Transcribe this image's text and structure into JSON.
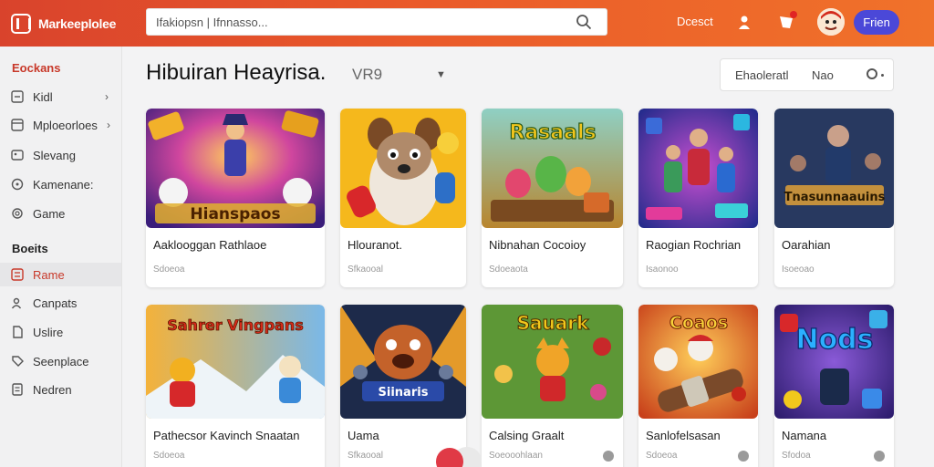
{
  "app": {
    "name": "Markeeplolee"
  },
  "header": {
    "search_text": "Ifakiopsn | Ifnnasso...",
    "link": "Dcesct",
    "notif_badge": "",
    "button": "Frien"
  },
  "sidebar": {
    "section1": "Eockans",
    "items1": [
      {
        "label": "Kidl",
        "chev": "›"
      },
      {
        "label": "Mploeorloes",
        "chev": "›"
      },
      {
        "label": "Slevang",
        "chev": ""
      },
      {
        "label": "Kamenane:",
        "chev": ""
      },
      {
        "label": "Game",
        "chev": ""
      }
    ],
    "section2": "Boeits",
    "items2": [
      {
        "label": "Rame"
      },
      {
        "label": "Canpats"
      },
      {
        "label": "Uslire"
      },
      {
        "label": "Seenplace"
      },
      {
        "label": "Nedren"
      }
    ]
  },
  "main": {
    "title": "Hibuiran Heayrisa.",
    "version": "VR9",
    "filter": {
      "a": "Ehaoleratl",
      "b": "Nao"
    }
  },
  "cards": [
    {
      "title": "Aaklooggan Rathlaoe",
      "sub": "Sdoeoa",
      "art": "Hianspaos"
    },
    {
      "title": "Hlouranot.",
      "sub": "Sfkaooal",
      "art": ""
    },
    {
      "title": "Nibnahan Cocoioy",
      "sub": "Sdoeaota",
      "art": "Rasaals"
    },
    {
      "title": "Raogian Rochrian",
      "sub": "Isaonoo",
      "art": ""
    },
    {
      "title": "Oarahian",
      "sub": "Isoeoao",
      "art": "Tnasunnaauins"
    },
    {
      "title": "Pathecsor Kavinch Snaatan",
      "sub": "Sdoeoa",
      "art": "Sahrer Vingpans"
    },
    {
      "title": "Uama",
      "sub": "Sfkaooal",
      "art": "Siinaris"
    },
    {
      "title": "Calsing Graalt",
      "sub": "Soeooohlaan",
      "art": "Sauark"
    },
    {
      "title": "Sanlofelsasan",
      "sub": "Sdoeoa",
      "art": "Coaos"
    },
    {
      "title": "Namana",
      "sub": "Sfodoa",
      "art": "Nods"
    }
  ]
}
